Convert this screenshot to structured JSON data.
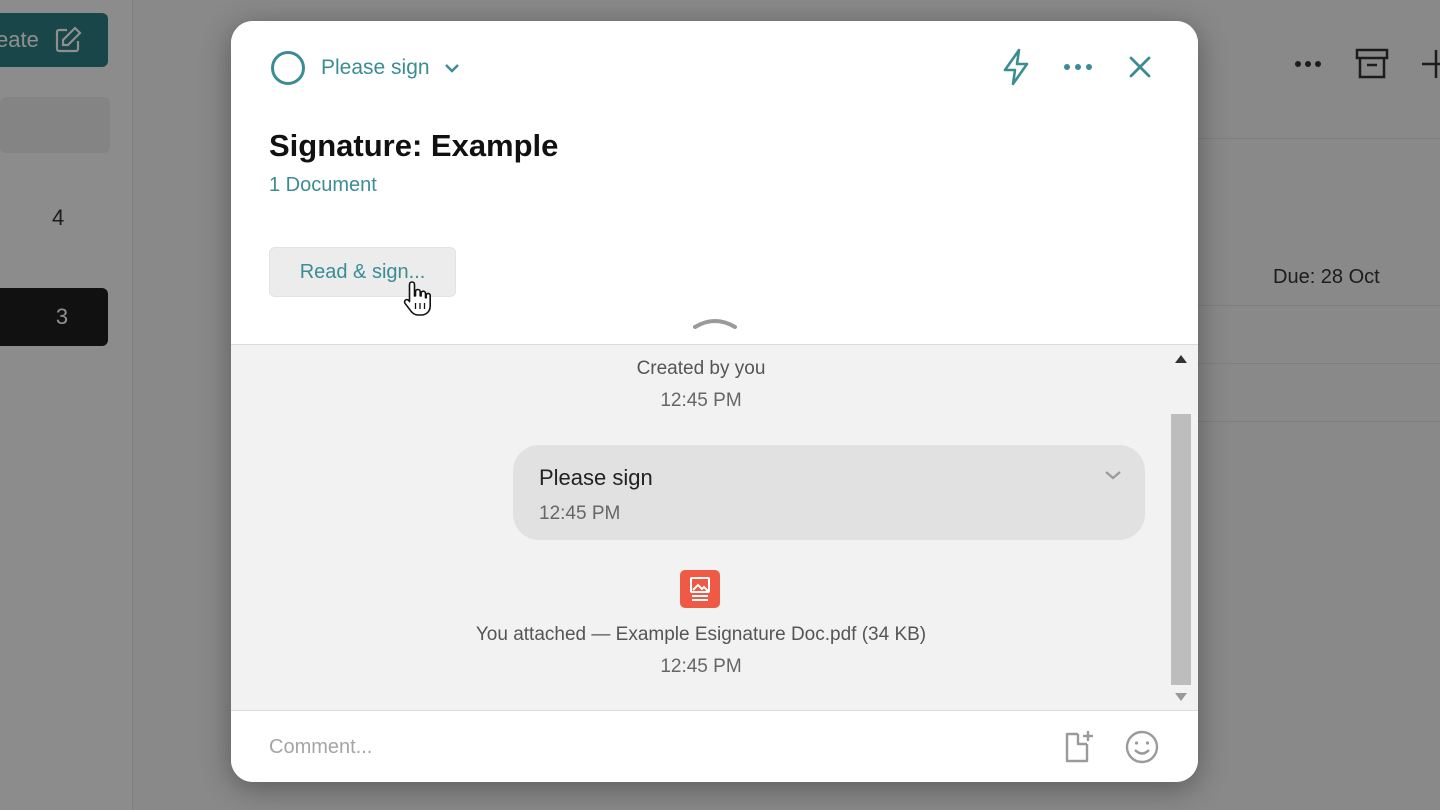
{
  "background": {
    "create_label": "eate",
    "count_a": "4",
    "count_b": "3",
    "due_label": "Due: 28 Oct"
  },
  "modal": {
    "status_label": "Please sign",
    "title": "Signature: Example",
    "doc_count": "1 Document",
    "read_sign_label": "Read & sign...",
    "activity": {
      "created_label": "Created by you",
      "created_time": "12:45 PM",
      "message_text": "Please sign",
      "message_time": "12:45 PM",
      "attachment_label": "You attached — Example Esignature Doc.pdf (34 KB)",
      "attachment_time": "12:45 PM"
    },
    "comment_placeholder": "Comment..."
  },
  "colors": {
    "accent": "#3b8d93",
    "pdf_badge": "#ee5a46"
  }
}
